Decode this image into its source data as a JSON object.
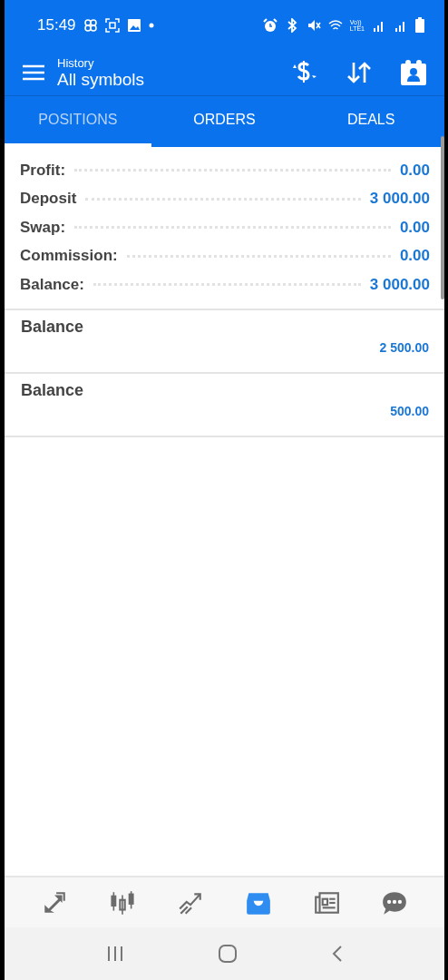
{
  "status_bar": {
    "time": "15:49",
    "network_top": "Vo))",
    "network_bottom": "LTE1"
  },
  "header": {
    "subtitle": "History",
    "title": "All symbols"
  },
  "tabs": [
    {
      "label": "POSITIONS",
      "selected": true
    },
    {
      "label": "ORDERS",
      "selected": false
    },
    {
      "label": "DEALS",
      "selected": false
    }
  ],
  "summary": [
    {
      "label": "Profit:",
      "value": "0.00"
    },
    {
      "label": "Deposit",
      "value": "3 000.00"
    },
    {
      "label": "Swap:",
      "value": "0.00"
    },
    {
      "label": "Commission:",
      "value": "0.00"
    },
    {
      "label": "Balance:",
      "value": "3 000.00"
    }
  ],
  "deals": [
    {
      "title": "Balance",
      "amount": "2 500.00"
    },
    {
      "title": "Balance",
      "amount": "500.00"
    }
  ],
  "bottom_nav": [
    {
      "kind": "trade",
      "selected": false
    },
    {
      "kind": "chart",
      "selected": false
    },
    {
      "kind": "trend",
      "selected": false
    },
    {
      "kind": "history",
      "selected": true
    },
    {
      "kind": "news",
      "selected": false
    },
    {
      "kind": "chat",
      "selected": false
    }
  ]
}
